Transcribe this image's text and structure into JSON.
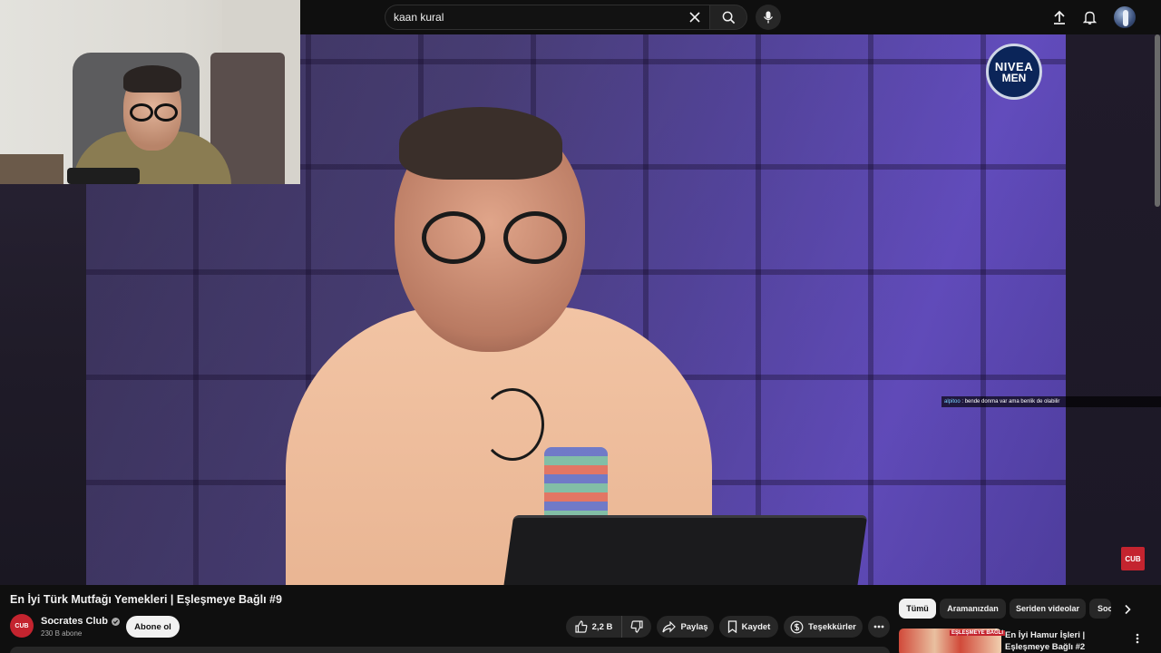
{
  "search": {
    "query": "kaan kural"
  },
  "video": {
    "title": "En İyi Türk Mutfağı Yemekleri | Eşleşmeye Bağlı #9",
    "sponsor_line1": "NIVEA",
    "sponsor_line2": "MEN",
    "corner_badge": "CUB"
  },
  "chat_overlay": {
    "user": "alpitoo",
    "separator": " : ",
    "message": "bende donma var ama benlik de olabilir"
  },
  "channel": {
    "avatar_text": "CUB",
    "name": "Socrates Club",
    "subscribers": "230 B abone",
    "subscribe_label": "Abone ol"
  },
  "actions": {
    "like_count": "2,2 B",
    "share_label": "Paylaş",
    "save_label": "Kaydet",
    "thanks_label": "Teşekkürler"
  },
  "chips": [
    {
      "label": "Tümü",
      "active": true
    },
    {
      "label": "Aramanızdan",
      "active": false
    },
    {
      "label": "Seriden videolar",
      "active": false
    },
    {
      "label": "Socrates Club",
      "active": false
    }
  ],
  "recommendations": [
    {
      "thumb_label": "EŞLEŞMEYE BAĞLI",
      "title": "En İyi Hamur İşleri | Eşleşmeye Bağlı #2"
    }
  ],
  "icons": {
    "clear": "close-icon",
    "search": "search-icon",
    "mic": "mic-icon",
    "upload": "upload-icon",
    "notifications": "bell-icon",
    "like": "thumbs-up-icon",
    "dislike": "thumbs-down-icon",
    "share": "share-icon",
    "save": "bookmark-icon",
    "thanks": "thanks-icon",
    "more": "more-horizontal-icon",
    "chip_next": "chevron-right-icon"
  },
  "colors": {
    "background": "#0f0f0f",
    "pill": "#272727",
    "brand_red": "#c4242f",
    "text": "#f1f1f1",
    "secondary_text": "#aaaaaa"
  }
}
